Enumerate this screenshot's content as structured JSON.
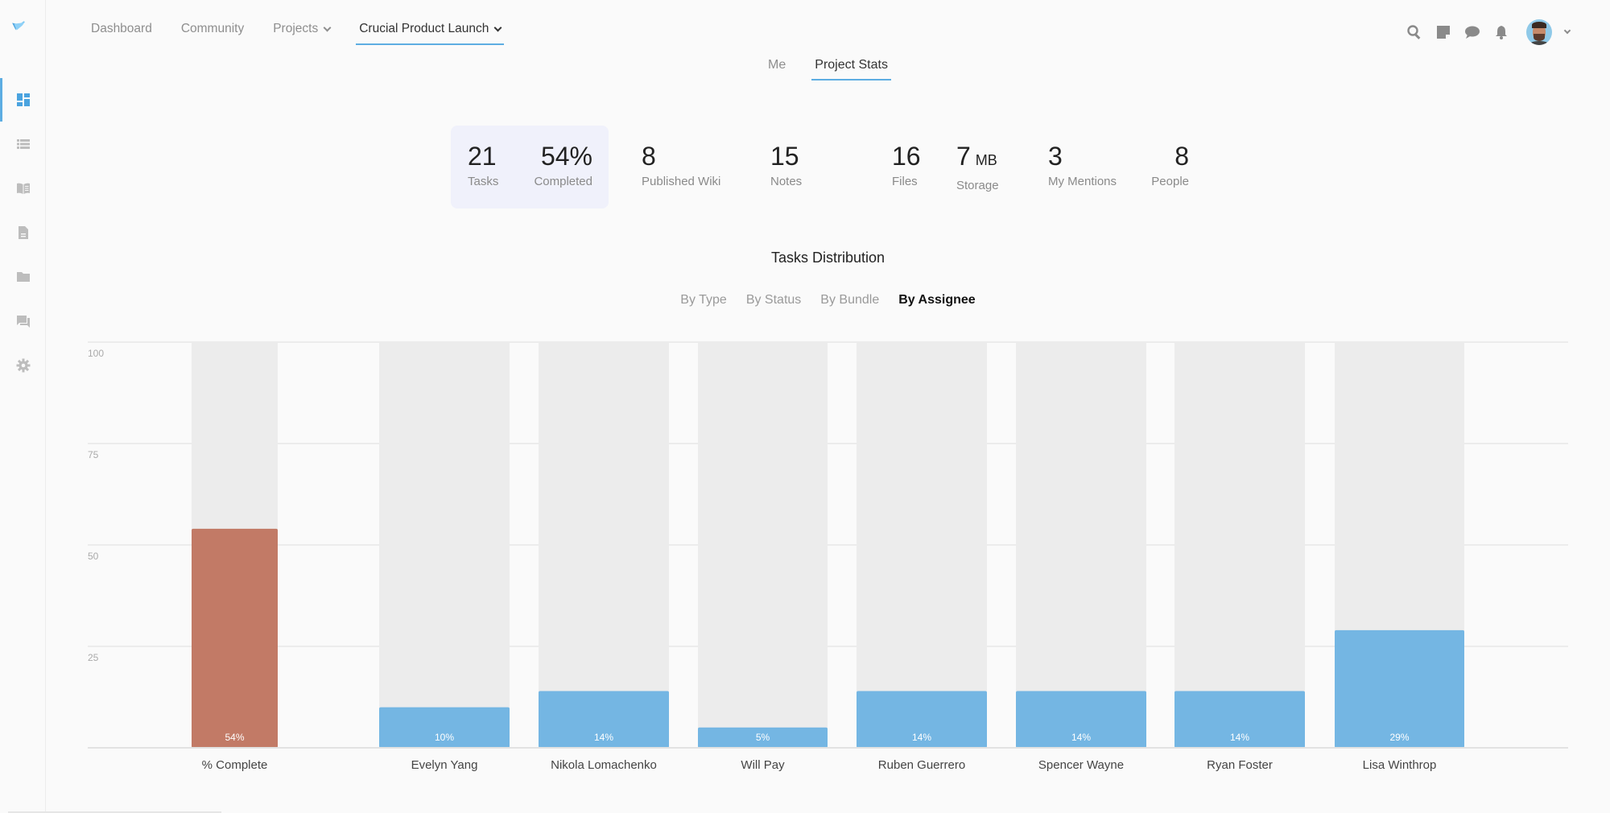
{
  "topnav": {
    "items": [
      {
        "label": "Dashboard",
        "dropdown": false,
        "active": false
      },
      {
        "label": "Community",
        "dropdown": false,
        "active": false
      },
      {
        "label": "Projects",
        "dropdown": true,
        "active": false
      },
      {
        "label": "Crucial Product Launch",
        "dropdown": true,
        "active": true
      }
    ]
  },
  "sidebar": {
    "items": [
      {
        "icon": "dashboard-icon",
        "active": true
      },
      {
        "icon": "list-icon",
        "active": false
      },
      {
        "icon": "wiki-book-icon",
        "active": false
      },
      {
        "icon": "document-icon",
        "active": false
      },
      {
        "icon": "folder-icon",
        "active": false
      },
      {
        "icon": "chat-icon",
        "active": false
      },
      {
        "icon": "gear-icon",
        "active": false
      }
    ]
  },
  "header_icons": [
    "search-icon",
    "sticky-note-icon",
    "chat-bubble-icon",
    "bell-icon"
  ],
  "subtabs": [
    {
      "label": "Me",
      "active": false
    },
    {
      "label": "Project Stats",
      "active": true
    }
  ],
  "stats": {
    "tasks": {
      "value": "21",
      "label": "Tasks"
    },
    "completed": {
      "value": "54%",
      "label": "Completed"
    },
    "wiki": {
      "value": "8",
      "label": "Published Wiki"
    },
    "notes": {
      "value": "15",
      "label": "Notes"
    },
    "files": {
      "value": "16",
      "label": "Files"
    },
    "storage": {
      "value": "7",
      "unit": "MB",
      "label": "Storage"
    },
    "mentions": {
      "value": "3",
      "label": "My Mentions"
    },
    "people": {
      "value": "8",
      "label": "People"
    }
  },
  "distribution": {
    "title": "Tasks Distribution",
    "tabs": [
      {
        "label": "By Type",
        "active": false
      },
      {
        "label": "By Status",
        "active": false
      },
      {
        "label": "By Bundle",
        "active": false
      },
      {
        "label": "By Assignee",
        "active": true
      }
    ]
  },
  "chart_data": {
    "type": "bar",
    "title": "Tasks Distribution",
    "xlabel": "",
    "ylabel": "",
    "ylim": [
      0,
      100
    ],
    "yticks": [
      25,
      50,
      75,
      100
    ],
    "grid": true,
    "categories": [
      "% Complete",
      "Evelyn Yang",
      "Nikola Lomachenko",
      "Will Pay",
      "Ruben Guerrero",
      "Spencer Wayne",
      "Ryan Foster",
      "Lisa Winthrop"
    ],
    "values": [
      54,
      10,
      14,
      5,
      14,
      14,
      14,
      29
    ],
    "value_labels": [
      "54%",
      "10%",
      "14%",
      "5%",
      "14%",
      "14%",
      "14%",
      "29%"
    ],
    "colors": [
      "#c27a66",
      "#74b6e3",
      "#74b6e3",
      "#74b6e3",
      "#74b6e3",
      "#74b6e3",
      "#74b6e3",
      "#74b6e3"
    ],
    "background_color": "#ececec",
    "gridline_color": "#e8e8e8"
  }
}
